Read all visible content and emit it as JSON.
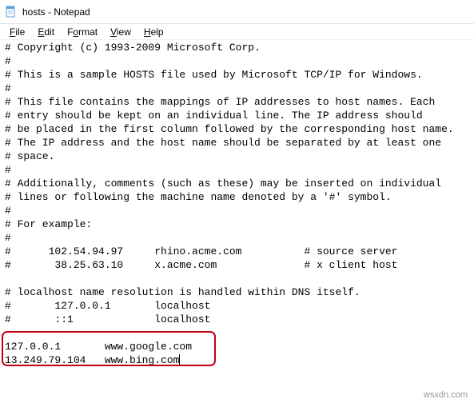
{
  "window": {
    "title": "hosts - Notepad"
  },
  "menu": {
    "file": "File",
    "edit": "Edit",
    "format": "Format",
    "view": "View",
    "help": "Help"
  },
  "content": {
    "lines": [
      "# Copyright (c) 1993-2009 Microsoft Corp.",
      "#",
      "# This is a sample HOSTS file used by Microsoft TCP/IP for Windows.",
      "#",
      "# This file contains the mappings of IP addresses to host names. Each",
      "# entry should be kept on an individual line. The IP address should",
      "# be placed in the first column followed by the corresponding host name.",
      "# The IP address and the host name should be separated by at least one",
      "# space.",
      "#",
      "# Additionally, comments (such as these) may be inserted on individual",
      "# lines or following the machine name denoted by a '#' symbol.",
      "#",
      "# For example:",
      "#",
      "#      102.54.94.97     rhino.acme.com          # source server",
      "#       38.25.63.10     x.acme.com              # x client host",
      "",
      "# localhost name resolution is handled within DNS itself.",
      "#       127.0.0.1       localhost",
      "#       ::1             localhost",
      "",
      "127.0.0.1       www.google.com",
      "13.249.79.104   www.bing.com"
    ]
  },
  "highlight": {
    "entries": [
      {
        "ip": "127.0.0.1",
        "host": "www.google.com"
      },
      {
        "ip": "13.249.79.104",
        "host": "www.bing.com"
      }
    ]
  },
  "watermark": "wsxdn.com"
}
